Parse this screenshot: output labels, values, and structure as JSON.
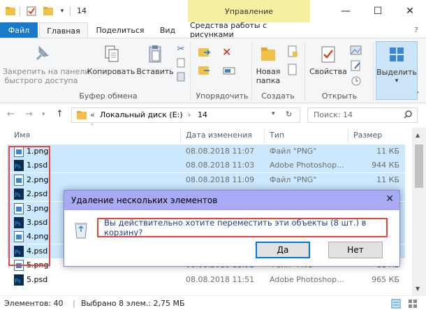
{
  "title": {
    "folder": "14",
    "context_group": "Управление"
  },
  "window_buttons": {
    "minimize": "—",
    "maximize": "☐",
    "close": "✕"
  },
  "tabs": {
    "file": "Файл",
    "home": "Главная",
    "share": "Поделиться",
    "view": "Вид",
    "picture_tools": "Средства работы с рисунками"
  },
  "ribbon": {
    "pin_line1": "Закрепить на панели",
    "pin_line2": "быстрого доступа",
    "copy": "Копировать",
    "paste": "Вставить",
    "group_clipboard": "Буфер обмена",
    "group_organize": "Упорядочить",
    "new_folder_line1": "Новая",
    "new_folder_line2": "папка",
    "group_create": "Создать",
    "properties": "Свойства",
    "group_open": "Открыть",
    "select": "Выделить"
  },
  "address": {
    "chevrons": "«",
    "drive": "Локальный диск (E:)",
    "folder": "14",
    "search_placeholder": "Поиск: 14"
  },
  "columns": {
    "name": "Имя",
    "date": "Дата изменения",
    "type": "Тип",
    "size": "Размер"
  },
  "files": [
    {
      "name": "1.png",
      "date": "08.08.2018 11:07",
      "type": "Файл \"PNG\"",
      "size": "11 КБ",
      "kind": "png",
      "selected": true
    },
    {
      "name": "1.psd",
      "date": "08.08.2018 11:03",
      "type": "Adobe Photoshop...",
      "size": "944 КБ",
      "kind": "psd",
      "selected": true
    },
    {
      "name": "2.png",
      "date": "08.08.2018 11:09",
      "type": "Файл \"PNG\"",
      "size": "11 КБ",
      "kind": "png",
      "selected": true
    },
    {
      "name": "2.psd",
      "date": "",
      "type": "",
      "size": "",
      "kind": "psd",
      "selected": true
    },
    {
      "name": "3.png",
      "date": "",
      "type": "",
      "size": "",
      "kind": "png",
      "selected": true
    },
    {
      "name": "3.psd",
      "date": "",
      "type": "",
      "size": "",
      "kind": "psd",
      "selected": true
    },
    {
      "name": "4.png",
      "date": "",
      "type": "",
      "size": "",
      "kind": "png",
      "selected": true
    },
    {
      "name": "4.psd",
      "date": "",
      "type": "",
      "size": "",
      "kind": "psd",
      "selected": true
    },
    {
      "name": "5.png",
      "date": "08.08.2018 11:52",
      "type": "Файл \"PNG\"",
      "size": "11 КБ",
      "kind": "png",
      "selected": false
    },
    {
      "name": "5.psd",
      "date": "08.08.2018 11:51",
      "type": "Adobe Photoshop...",
      "size": "965 КБ",
      "kind": "psd",
      "selected": false
    }
  ],
  "status": {
    "count": "Элементов: 40",
    "selected": "Выбрано 8 элем.: 2,75 МБ"
  },
  "dialog": {
    "title": "Удаление нескольких элементов",
    "message": "Вы действительно хотите переместить эти объекты (8 шт.) в корзину?",
    "yes": "Да",
    "no": "Нет",
    "close": "✕"
  },
  "colors": {
    "accent": "#1979ca",
    "selection": "#cce8ff",
    "highlight": "#e8443a",
    "dialog_title": "#a9aaf3",
    "context_tab": "#f7f0a0"
  }
}
